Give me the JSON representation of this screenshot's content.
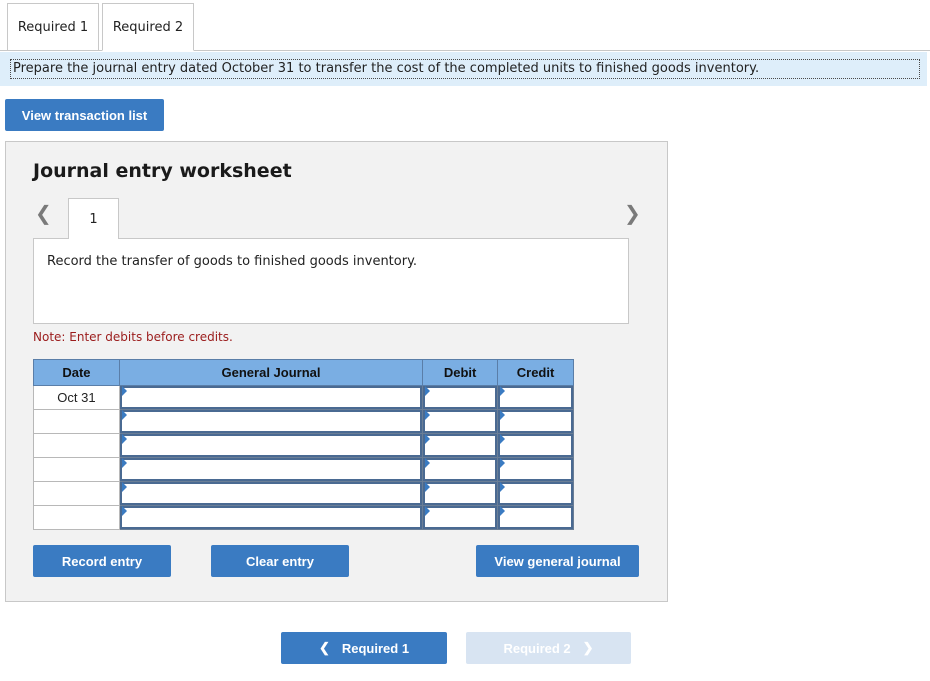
{
  "tabs": [
    {
      "label": "Required 1",
      "active": false
    },
    {
      "label": "Required 2",
      "active": true
    }
  ],
  "instruction": "Prepare the journal entry dated October 31 to transfer the cost of the completed units to finished goods inventory.",
  "view_transaction_list": "View transaction list",
  "worksheet": {
    "title": "Journal entry worksheet",
    "current_page": "1",
    "prev_icon": "chevron-left-icon",
    "next_icon": "chevron-right-icon",
    "description": "Record the transfer of goods to finished goods inventory.",
    "note": "Note: Enter debits before credits.",
    "table": {
      "headers": {
        "date": "Date",
        "journal": "General Journal",
        "debit": "Debit",
        "credit": "Credit"
      },
      "rows": [
        {
          "date": "Oct 31",
          "account": "",
          "debit": "",
          "credit": ""
        },
        {
          "date": "",
          "account": "",
          "debit": "",
          "credit": ""
        },
        {
          "date": "",
          "account": "",
          "debit": "",
          "credit": ""
        },
        {
          "date": "",
          "account": "",
          "debit": "",
          "credit": ""
        },
        {
          "date": "",
          "account": "",
          "debit": "",
          "credit": ""
        },
        {
          "date": "",
          "account": "",
          "debit": "",
          "credit": ""
        }
      ]
    },
    "buttons": {
      "record": "Record entry",
      "clear": "Clear entry",
      "view_journal": "View general journal"
    }
  },
  "nav": {
    "prev_label": "Required 1",
    "next_label": "Required 2",
    "next_disabled": true
  },
  "colors": {
    "accent": "#3a7bc2",
    "header_blue": "#7aaee3",
    "instruction_bg": "#deeefa",
    "note_red": "#9b1c1c"
  }
}
